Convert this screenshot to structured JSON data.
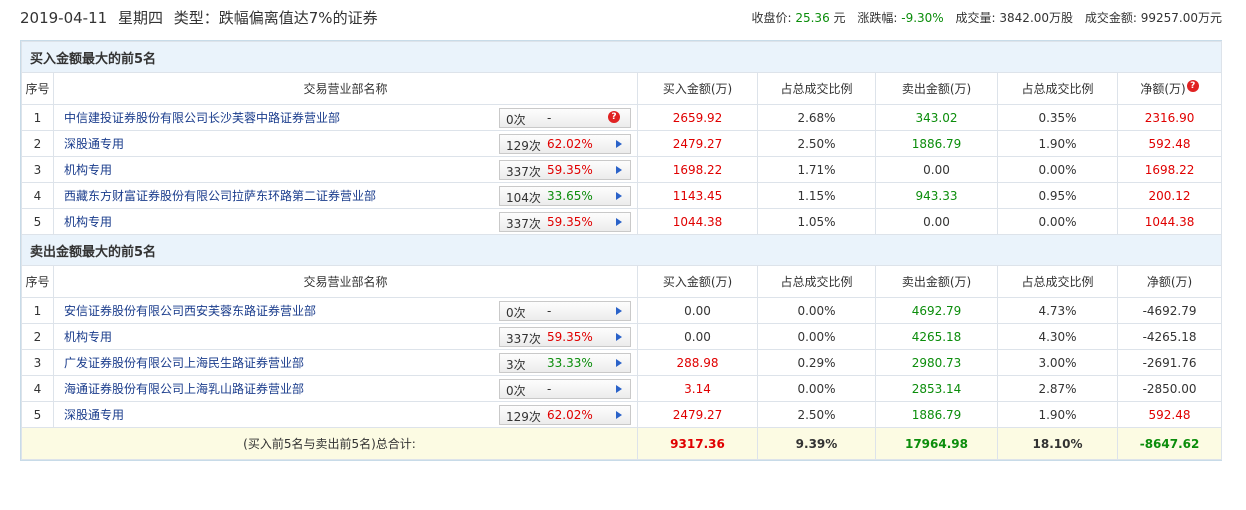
{
  "header": {
    "date": "2019-04-11",
    "weekday": "星期四",
    "type_text": "类型：跌幅偏离值达7%的证券",
    "close_label": "收盘价:",
    "close_value": "25.36",
    "close_unit": "元",
    "change_label": "涨跌幅:",
    "change_value": "-9.30%",
    "volume_label": "成交量:",
    "volume_value": "3842.00万股",
    "amount_label": "成交金额:",
    "amount_value": "99257.00万元"
  },
  "columns": {
    "seq": "序号",
    "name": "交易营业部名称",
    "buy": "买入金额(万)",
    "buy_pct": "占总成交比例",
    "sell": "卖出金额(万)",
    "sell_pct": "占总成交比例",
    "net": "净额(万)"
  },
  "buy_section": {
    "title": "买入金额最大的前5名",
    "rows": [
      {
        "seq": "1",
        "name": "中信建投证券股份有限公司长沙芙蓉中路证券营业部",
        "count": "0次",
        "rate": "-",
        "rate_color": "black",
        "help": true,
        "buy": "2659.92",
        "buy_pct": "2.68%",
        "sell": "343.02",
        "sell_pct": "0.35%",
        "net": "2316.90"
      },
      {
        "seq": "2",
        "name": "深股通专用",
        "count": "129次",
        "rate": "62.02%",
        "rate_color": "red",
        "help": false,
        "buy": "2479.27",
        "buy_pct": "2.50%",
        "sell": "1886.79",
        "sell_pct": "1.90%",
        "net": "592.48"
      },
      {
        "seq": "3",
        "name": "机构专用",
        "count": "337次",
        "rate": "59.35%",
        "rate_color": "red",
        "help": false,
        "buy": "1698.22",
        "buy_pct": "1.71%",
        "sell": "0.00",
        "sell_pct": "0.00%",
        "net": "1698.22"
      },
      {
        "seq": "4",
        "name": "西藏东方财富证券股份有限公司拉萨东环路第二证券营业部",
        "count": "104次",
        "rate": "33.65%",
        "rate_color": "green",
        "help": false,
        "buy": "1143.45",
        "buy_pct": "1.15%",
        "sell": "943.33",
        "sell_pct": "0.95%",
        "net": "200.12"
      },
      {
        "seq": "5",
        "name": "机构专用",
        "count": "337次",
        "rate": "59.35%",
        "rate_color": "red",
        "help": false,
        "buy": "1044.38",
        "buy_pct": "1.05%",
        "sell": "0.00",
        "sell_pct": "0.00%",
        "net": "1044.38"
      }
    ]
  },
  "sell_section": {
    "title": "卖出金额最大的前5名",
    "rows": [
      {
        "seq": "1",
        "name": "安信证券股份有限公司西安芙蓉东路证券营业部",
        "count": "0次",
        "rate": "-",
        "rate_color": "black",
        "buy": "0.00",
        "buy_color": "black",
        "buy_pct": "0.00%",
        "sell": "4692.79",
        "sell_pct": "4.73%",
        "net": "-4692.79"
      },
      {
        "seq": "2",
        "name": "机构专用",
        "count": "337次",
        "rate": "59.35%",
        "rate_color": "red",
        "buy": "0.00",
        "buy_color": "black",
        "buy_pct": "0.00%",
        "sell": "4265.18",
        "sell_pct": "4.30%",
        "net": "-4265.18"
      },
      {
        "seq": "3",
        "name": "广发证券股份有限公司上海民生路证券营业部",
        "count": "3次",
        "rate": "33.33%",
        "rate_color": "green",
        "buy": "288.98",
        "buy_color": "red",
        "buy_pct": "0.29%",
        "sell": "2980.73",
        "sell_pct": "3.00%",
        "net": "-2691.76"
      },
      {
        "seq": "4",
        "name": "海通证券股份有限公司上海乳山路证券营业部",
        "count": "0次",
        "rate": "-",
        "rate_color": "black",
        "buy": "3.14",
        "buy_color": "red",
        "buy_pct": "0.00%",
        "sell": "2853.14",
        "sell_pct": "2.87%",
        "net": "-2850.00"
      },
      {
        "seq": "5",
        "name": "深股通专用",
        "count": "129次",
        "rate": "62.02%",
        "rate_color": "red",
        "buy": "2479.27",
        "buy_color": "red",
        "buy_pct": "2.50%",
        "sell": "1886.79",
        "sell_pct": "1.90%",
        "net": "592.48"
      }
    ]
  },
  "total": {
    "label": "(买入前5名与卖出前5名)总合计:",
    "buy": "9317.36",
    "buy_pct": "9.39%",
    "sell": "17964.98",
    "sell_pct": "18.10%",
    "net": "-8647.62"
  },
  "colors": {
    "red": "#e00000",
    "green": "#0b8d0b",
    "link": "#1a3c8c",
    "section_bg": "#eaf3fb",
    "total_bg": "#fcfbe3"
  },
  "icons": {
    "help": "question-circle-icon",
    "arrow": "play-arrow-icon"
  },
  "help_glyph": "?"
}
